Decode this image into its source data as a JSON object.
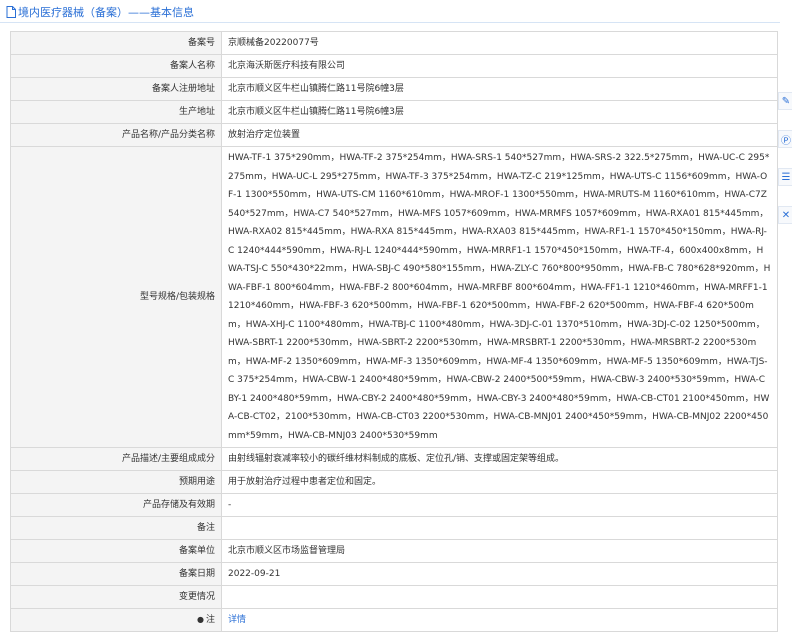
{
  "header": {
    "title": "境内医疗器械（备案）——基本信息"
  },
  "rows": [
    {
      "label": "备案号",
      "value": "京顺械备20220077号"
    },
    {
      "label": "备案人名称",
      "value": "北京海沃斯医疗科技有限公司"
    },
    {
      "label": "备案人注册地址",
      "value": "北京市顺义区牛栏山镇腾仁路11号院6幢3层"
    },
    {
      "label": "生产地址",
      "value": "北京市顺义区牛栏山镇腾仁路11号院6幢3层"
    },
    {
      "label": "产品名称/产品分类名称",
      "value": "放射治疗定位装置"
    },
    {
      "label": "型号规格/包装规格",
      "value": "HWA-TF-1 375*290mm，HWA-TF-2 375*254mm，HWA-SRS-1 540*527mm，HWA-SRS-2 322.5*275mm，HWA-UC-C 295*275mm，HWA-UC-L 295*275mm，HWA-TF-3 375*254mm，HWA-TZ-C 219*125mm，HWA-UTS-C 1156*609mm，HWA-OF-1 1300*550mm，HWA-UTS-CM 1160*610mm，HWA-MROF-1 1300*550mm，HWA-MRUTS-M 1160*610mm，HWA-C7Z 540*527mm，HWA-C7 540*527mm，HWA-MFS 1057*609mm，HWA-MRMFS 1057*609mm，HWA-RXA01 815*445mm，HWA-RXA02 815*445mm，HWA-RXA 815*445mm，HWA-RXA03 815*445mm，HWA-RF1-1 1570*450*150mm，HWA-RJ-C 1240*444*590mm，HWA-RJ-L 1240*444*590mm，HWA-MRRF1-1 1570*450*150mm，HWA-TF-4，600x400x8mm，HWA-TSJ-C 550*430*22mm，HWA-SBJ-C 490*580*155mm，HWA-ZLY-C 760*800*950mm，HWA-FB-C 780*628*920mm，HWA-FBF-1 800*604mm，HWA-FBF-2 800*604mm，HWA-MRFBF 800*604mm，HWA-FF1-1 1210*460mm，HWA-MRFF1-1 1210*460mm，HWA-FBF-3 620*500mm，HWA-FBF-1 620*500mm，HWA-FBF-2 620*500mm，HWA-FBF-4 620*500mm，HWA-XHJ-C 1100*480mm，HWA-TBJ-C 1100*480mm，HWA-3DJ-C-01 1370*510mm，HWA-3DJ-C-02 1250*500mm，HWA-SBRT-1 2200*530mm，HWA-SBRT-2 2200*530mm，HWA-MRSBRT-1 2200*530mm，HWA-MRSBRT-2 2200*530mm，HWA-MF-2 1350*609mm，HWA-MF-3 1350*609mm，HWA-MF-4 1350*609mm，HWA-MF-5 1350*609mm，HWA-TJS-C 375*254mm，HWA-CBW-1 2400*480*59mm，HWA-CBW-2 2400*500*59mm，HWA-CBW-3 2400*530*59mm，HWA-CBY-1 2400*480*59mm，HWA-CBY-2 2400*480*59mm，HWA-CBY-3 2400*480*59mm，HWA-CB-CT01 2100*450mm，HWA-CB-CT02，2100*530mm，HWA-CB-CT03 2200*530mm，HWA-CB-MNJ01 2400*450*59mm，HWA-CB-MNJ02 2200*450mm*59mm，HWA-CB-MNJ03 2400*530*59mm"
    },
    {
      "label": "产品描述/主要组成成分",
      "value": "由射线辐射衰减率较小的碳纤维材料制成的底板、定位孔/销、支撑或固定架等组成。"
    },
    {
      "label": "预期用途",
      "value": "用于放射治疗过程中患者定位和固定。"
    },
    {
      "label": "产品存储及有效期",
      "value": "-"
    },
    {
      "label": "备注",
      "value": ""
    },
    {
      "label": "备案单位",
      "value": "北京市顺义区市场监督管理局"
    },
    {
      "label": "备案日期",
      "value": "2022-09-21"
    },
    {
      "label": "变更情况",
      "value": ""
    },
    {
      "label": "注",
      "value": "详情"
    }
  ],
  "toolbar": {
    "icons": [
      "edit-icon",
      "brand-icon",
      "list-icon",
      "close-icon"
    ]
  },
  "colors": {
    "accent": "#2a6fd6",
    "label_bg": "#f4f4f4",
    "border": "#d9d9d9"
  }
}
